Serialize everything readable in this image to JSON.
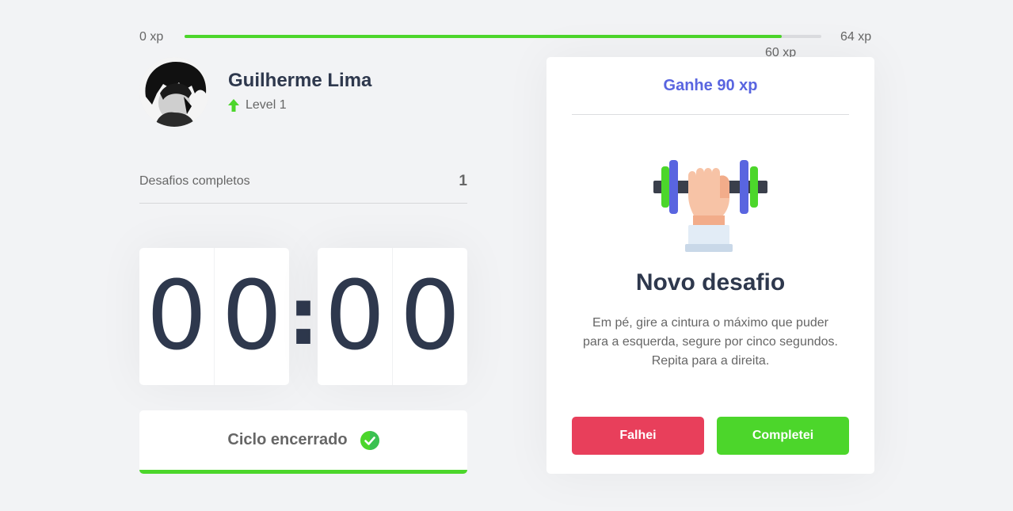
{
  "xp_bar": {
    "min_label": "0 xp",
    "max_label": "64 xp",
    "current_label": "60 xp",
    "progress_percent": 93.75,
    "fill_color": "#4cd62b"
  },
  "profile": {
    "name": "Guilherme Lima",
    "level": "Level 1",
    "level_icon": "level-up-arrow-icon"
  },
  "completed_challenges": {
    "label": "Desafios completos",
    "count": "1"
  },
  "countdown": {
    "minute_left": "0",
    "minute_right": "0",
    "second_left": "0",
    "second_right": "0",
    "separator": ":"
  },
  "cycle_button": {
    "label": "Ciclo encerrado",
    "icon": "check-circle-icon"
  },
  "challenge": {
    "header": "Ganhe 90 xp",
    "icon": "body-dumbbell-icon",
    "title": "Novo desafio",
    "description_lines": [
      "Em pé, gire a cintura o máximo que puder",
      "para a esquerda, segure por cinco segundos.",
      "Repita para a direita."
    ],
    "fail_label": "Falhei",
    "success_label": "Completei"
  },
  "colors": {
    "background": "#f2f3f5",
    "green": "#4cd62b",
    "red": "#e83f5b",
    "blue": "#5965e0",
    "title": "#2e384d",
    "text": "#666666"
  }
}
